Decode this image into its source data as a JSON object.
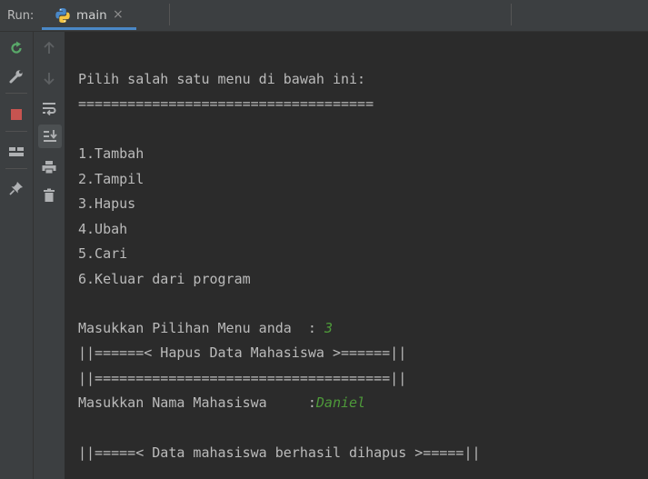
{
  "header": {
    "run_label": "Run:",
    "tab_title": "main",
    "tab_close": "×"
  },
  "toolbar_left": {
    "icons": [
      "rerun-icon",
      "settings-wrench-icon",
      "stop-icon",
      "layout-icon",
      "pin-icon"
    ]
  },
  "toolbar_right": {
    "icons": [
      "up-arrow-icon",
      "down-arrow-icon",
      "soft-wrap-icon",
      "scroll-to-end-icon",
      "print-icon",
      "trash-icon"
    ]
  },
  "console": {
    "partial_top": "======",
    "menu_prompt": "Pilih salah satu menu di bawah ini:",
    "divider": "====================================",
    "menu_items": [
      "1.Tambah",
      "2.Tampil",
      "3.Hapus",
      "4.Ubah",
      "5.Cari",
      "6.Keluar dari program"
    ],
    "choice_prompt": "Masukkan Pilihan Menu anda  : ",
    "choice_value": "3",
    "hapus_header": "||======< Hapus Data Mahasiswa >======||",
    "hapus_divider": "||====================================||",
    "name_prompt": "Masukkan Nama Mahasiswa     :",
    "name_value": "Daniel",
    "result_msg": "||=====< Data mahasiswa berhasil dihapus >=====||"
  },
  "colors": {
    "background": "#2b2b2b",
    "panel": "#3c3f41",
    "text": "#bbbbbb",
    "input_green": "#4e9a3a",
    "tab_accent": "#4a88c7",
    "stop_red": "#c75450"
  }
}
